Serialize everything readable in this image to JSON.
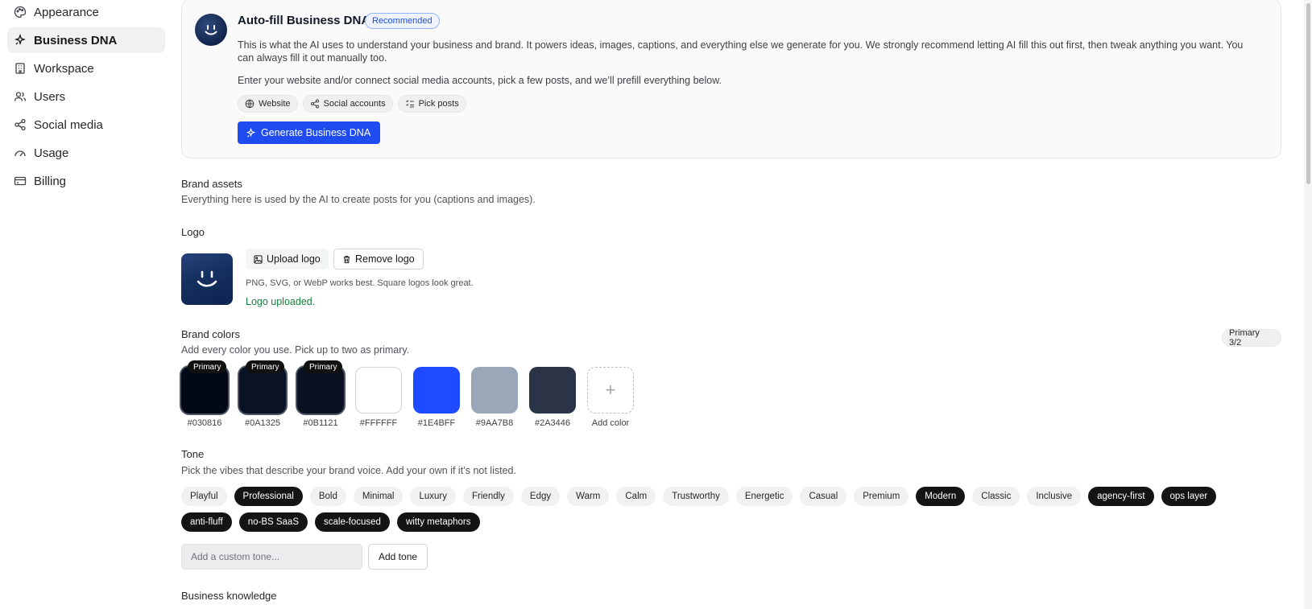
{
  "sidebar": {
    "items": [
      {
        "label": "Appearance",
        "icon": "palette-icon"
      },
      {
        "label": "Business DNA",
        "icon": "sparkle-icon",
        "active": true
      },
      {
        "label": "Workspace",
        "icon": "building-icon"
      },
      {
        "label": "Users",
        "icon": "users-icon"
      },
      {
        "label": "Social media",
        "icon": "share-icon"
      },
      {
        "label": "Usage",
        "icon": "gauge-icon"
      },
      {
        "label": "Billing",
        "icon": "credit-card-icon"
      }
    ]
  },
  "autofill": {
    "title": "Auto-fill Business DNA",
    "badge": "Recommended",
    "description": "This is what the AI uses to understand your business and brand. It powers ideas, images, captions, and everything else we generate for you. We strongly recommend letting AI fill this out first, then tweak anything you want. You can always fill it out manually too.",
    "instruction": "Enter your website and/or connect social media accounts, pick a few posts, and we’ll prefill everything below.",
    "chips": [
      "Website",
      "Social accounts",
      "Pick posts"
    ],
    "generate_label": "Generate Business DNA"
  },
  "brand_assets": {
    "title": "Brand assets",
    "subtitle": "Everything here is used by the AI to create posts for you (captions and images)."
  },
  "logo": {
    "title": "Logo",
    "upload_label": "Upload logo",
    "remove_label": "Remove logo",
    "hint": "PNG, SVG, or WebP works best. Square logos look great.",
    "status": "Logo uploaded."
  },
  "brand_colors": {
    "title": "Brand colors",
    "subtitle": "Add every color you use. Pick up to two as primary.",
    "primary_count": "Primary 3/2",
    "primary_tag": "Primary",
    "add_label": "Add color",
    "colors": [
      {
        "hex": "#030816",
        "primary": true
      },
      {
        "hex": "#0A1325",
        "primary": true
      },
      {
        "hex": "#0B1121",
        "primary": true
      },
      {
        "hex": "#FFFFFF",
        "primary": false
      },
      {
        "hex": "#1E4BFF",
        "primary": false
      },
      {
        "hex": "#9AA7B8",
        "primary": false
      },
      {
        "hex": "#2A3446",
        "primary": false
      }
    ]
  },
  "tone": {
    "title": "Tone",
    "subtitle": "Pick the vibes that describe your brand voice. Add your own if it’s not listed.",
    "row1": [
      {
        "label": "Playful",
        "on": false
      },
      {
        "label": "Professional",
        "on": true
      },
      {
        "label": "Bold",
        "on": false
      },
      {
        "label": "Minimal",
        "on": false
      },
      {
        "label": "Luxury",
        "on": false
      },
      {
        "label": "Friendly",
        "on": false
      },
      {
        "label": "Edgy",
        "on": false
      },
      {
        "label": "Warm",
        "on": false
      },
      {
        "label": "Calm",
        "on": false
      },
      {
        "label": "Trustworthy",
        "on": false
      },
      {
        "label": "Energetic",
        "on": false
      },
      {
        "label": "Casual",
        "on": false
      },
      {
        "label": "Premium",
        "on": false
      },
      {
        "label": "Modern",
        "on": true
      },
      {
        "label": "Classic",
        "on": false
      },
      {
        "label": "Inclusive",
        "on": false
      },
      {
        "label": "agency-first",
        "on": true
      },
      {
        "label": "ops layer",
        "on": true
      }
    ],
    "row2": [
      {
        "label": "anti-fluff",
        "on": true
      },
      {
        "label": "no-BS SaaS",
        "on": true
      },
      {
        "label": "scale-focused",
        "on": true
      },
      {
        "label": "witty metaphors",
        "on": true
      }
    ],
    "input_placeholder": "Add a custom tone...",
    "add_label": "Add tone"
  },
  "business_knowledge": {
    "title": "Business knowledge"
  }
}
